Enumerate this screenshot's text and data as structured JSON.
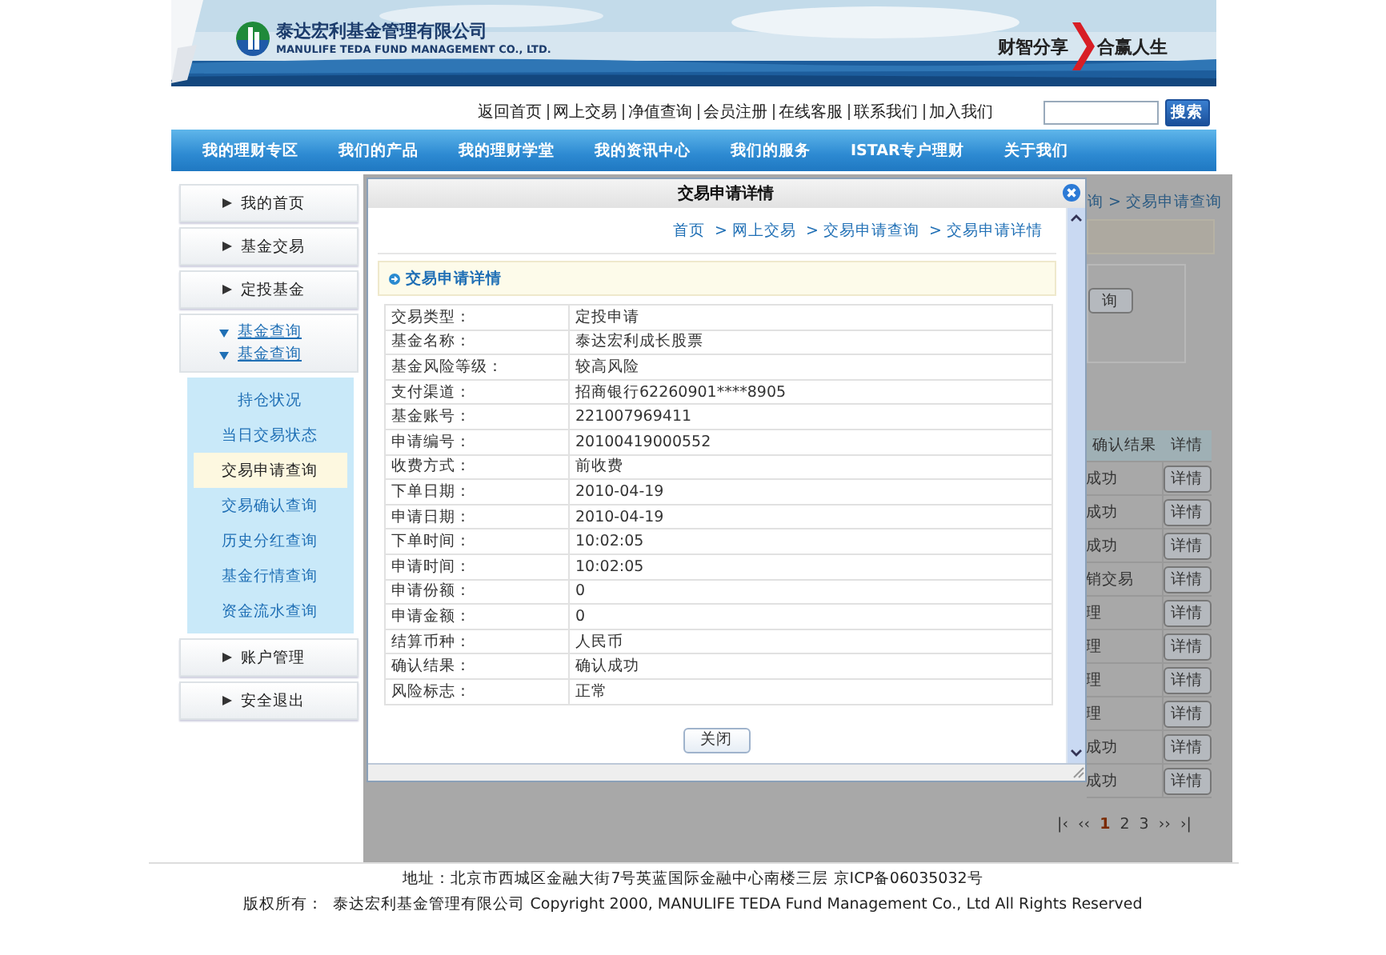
{
  "header": {
    "company_cn": "泰达宏利基金管理有限公司",
    "company_en": "MANULIFE TEDA FUND MANAGEMENT CO., LTD.",
    "slogan_left": "财智分享",
    "slogan_right": "合赢人生"
  },
  "top_links": [
    "返回首页",
    "网上交易",
    "净值查询",
    "会员注册",
    "在线客服",
    "联系我们",
    "加入我们"
  ],
  "search": {
    "button": "搜索"
  },
  "nav": [
    "我的理财专区",
    "我们的产品",
    "我的理财学堂",
    "我的资讯中心",
    "我们的服务",
    "ISTAR专户理财",
    "关于我们"
  ],
  "sidebar": {
    "items": [
      {
        "kind": "link",
        "label": "我的首页"
      },
      {
        "kind": "link",
        "label": "基金交易"
      },
      {
        "kind": "link",
        "label": "定投基金"
      },
      {
        "kind": "group",
        "expanded": true,
        "headings": [
          "基金查询",
          "基金查询"
        ],
        "children": [
          {
            "label": "持仓状况",
            "selected": false
          },
          {
            "label": "当日交易状态",
            "selected": false
          },
          {
            "label": "交易申请查询",
            "selected": true
          },
          {
            "label": "交易确认查询",
            "selected": false
          },
          {
            "label": "历史分红查询",
            "selected": false
          },
          {
            "label": "基金行情查询",
            "selected": false
          },
          {
            "label": "资金流水查询",
            "selected": false
          }
        ]
      },
      {
        "kind": "link",
        "label": "账户管理"
      },
      {
        "kind": "link",
        "label": "安全退出"
      }
    ]
  },
  "background_page": {
    "breadcrumb": "询 > 交易申请查询",
    "query_button": "询",
    "table": {
      "columns": [
        "确认结果",
        "详情"
      ],
      "rows": [
        {
          "result": "成功",
          "action": "详情"
        },
        {
          "result": "成功",
          "action": "详情"
        },
        {
          "result": "成功",
          "action": "详情"
        },
        {
          "result": "销交易",
          "action": "详情"
        },
        {
          "result": "理",
          "action": "详情"
        },
        {
          "result": "理",
          "action": "详情"
        },
        {
          "result": "理",
          "action": "详情"
        },
        {
          "result": "理",
          "action": "详情"
        },
        {
          "result": "成功",
          "action": "详情"
        },
        {
          "result": "成功",
          "action": "详情"
        }
      ]
    },
    "pagination": {
      "first": "|‹",
      "prev": "‹‹",
      "pages": [
        {
          "label": "1",
          "selected": true
        },
        {
          "label": "2",
          "selected": false
        },
        {
          "label": "3",
          "selected": false
        }
      ],
      "next": "››",
      "last": "›|"
    }
  },
  "dialog": {
    "title": "交易申请详情",
    "breadcrumb": [
      "首页",
      "> 网上交易",
      "> 交易申请查询",
      "> 交易申请详情"
    ],
    "section_title": "交易申请详情",
    "fields": [
      {
        "label": "交易类型：",
        "value": "定投申请"
      },
      {
        "label": "基金名称：",
        "value": "泰达宏利成长股票"
      },
      {
        "label": "基金风险等级：",
        "value": "较高风险"
      },
      {
        "label": "支付渠道：",
        "value": "招商银行62260901****8905"
      },
      {
        "label": "基金账号：",
        "value": "221007969411"
      },
      {
        "label": "申请编号：",
        "value": "20100419000552"
      },
      {
        "label": "收费方式：",
        "value": "前收费"
      },
      {
        "label": "下单日期：",
        "value": "2010-04-19"
      },
      {
        "label": "申请日期：",
        "value": "2010-04-19"
      },
      {
        "label": "下单时间：",
        "value": "10:02:05"
      },
      {
        "label": "申请时间：",
        "value": "10:02:05"
      },
      {
        "label": "申请份额：",
        "value": "0"
      },
      {
        "label": "申请金额：",
        "value": "0"
      },
      {
        "label": "结算币种：",
        "value": "人民币"
      },
      {
        "label": "确认结果：",
        "value": "确认成功"
      },
      {
        "label": "风险标志：",
        "value": "正常"
      }
    ],
    "close_button": "关闭"
  },
  "footer": {
    "address": "地址：北京市西城区金融大街7号英蓝国际金融中心南楼三层  京ICP备06035032号",
    "copyright_label": "版权所有：",
    "copyright": "泰达宏利基金管理有限公司  Copyright 2000, MANULIFE TEDA Fund Management Co., Ltd All Rights Reserved"
  }
}
